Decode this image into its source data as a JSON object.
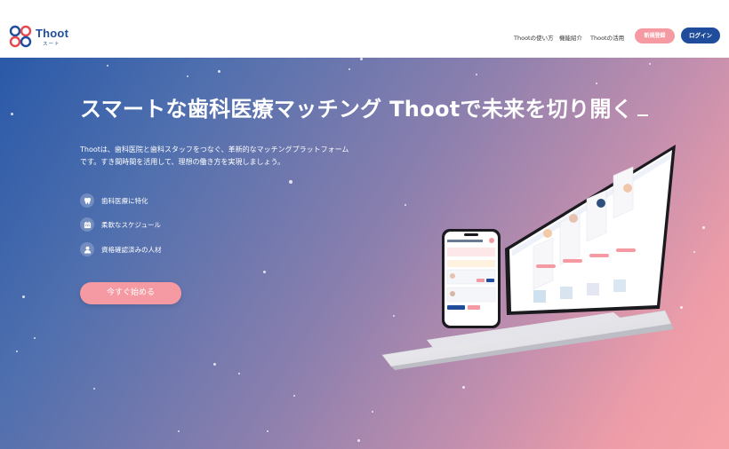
{
  "header": {
    "logo_text": "Thoot",
    "logo_sub": "スート",
    "nav": [
      "Thootの使い方",
      "機能紹介",
      "Thootの活用"
    ],
    "register_label": "新規登録",
    "login_label": "ログイン"
  },
  "hero": {
    "headline": "スマートな歯科医療マッチング Thootで未来を切り開く",
    "description_line1": "Thootは、歯科医院と歯科スタッフをつなぐ、革新的なマッチングプラットフォーム",
    "description_line2": "です。すき間時間を活用して、理想の働き方を実現しましょう。",
    "features": [
      {
        "icon": "tooth-icon",
        "label": "歯科医療に特化"
      },
      {
        "icon": "calendar-icon",
        "label": "柔軟なスケジュール"
      },
      {
        "icon": "person-icon",
        "label": "資格確認済みの人材"
      }
    ],
    "cta_label": "今すぐ始める"
  },
  "colors": {
    "brand_blue": "#1f4d9c",
    "brand_pink": "#f59aa2",
    "logo_red": "#e5484d"
  }
}
